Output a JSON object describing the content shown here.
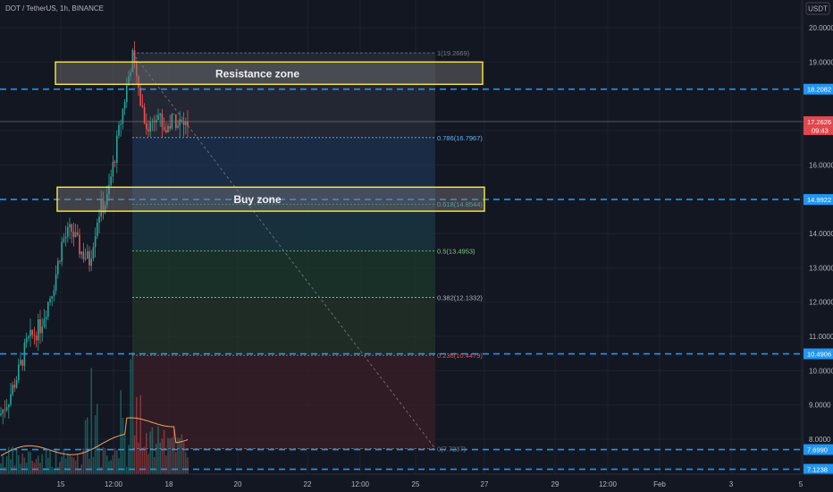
{
  "header": {
    "title": "DOT / TetherUS, 1h, BINANCE"
  },
  "colors": {
    "background": "#131722",
    "grid": "#1e2230",
    "up_candle": "#26a69a",
    "down_candle": "#ef5350",
    "blue_line": "#2196f3",
    "zone_border": "#ffeb3b",
    "fib_upper": "#2a4a6b",
    "fib_mid": "#1e4a3a",
    "fib_lower": "#5a2a30",
    "ma_line": "#f4a261"
  },
  "chart_data": {
    "type": "candlestick",
    "symbol": "DOT / TetherUS",
    "interval": "1h",
    "exchange": "BINANCE",
    "currency": "USDT",
    "ylim": [
      7.0,
      20.3
    ],
    "y_ticks": [
      "20.0000",
      "19.0000",
      "17.0000",
      "16.0000",
      "14.0000",
      "13.0000",
      "12.0000",
      "11.0000",
      "10.0000",
      "9.0000",
      "8.0000"
    ],
    "x_ticks": [
      "15",
      "12:00",
      "18",
      "20",
      "22",
      "12:00",
      "25",
      "27",
      "29",
      "12:00",
      "Feb",
      "3",
      "5"
    ],
    "price_path": [
      [
        0,
        8.7
      ],
      [
        10,
        9.2
      ],
      [
        20,
        9.9
      ],
      [
        30,
        10.8
      ],
      [
        45,
        11.3
      ],
      [
        60,
        12.5
      ],
      [
        70,
        13.8
      ],
      [
        80,
        14.1
      ],
      [
        90,
        13.5
      ],
      [
        100,
        13.2
      ],
      [
        110,
        14.6
      ],
      [
        120,
        15.0
      ],
      [
        130,
        16.5
      ],
      [
        140,
        18.0
      ],
      [
        148,
        19.2
      ],
      [
        155,
        18.2
      ],
      [
        165,
        17.0
      ],
      [
        175,
        17.6
      ],
      [
        185,
        17.0
      ],
      [
        195,
        17.4
      ],
      [
        205,
        17.1
      ],
      [
        212,
        17.3
      ]
    ],
    "horizontal_levels": [
      {
        "label": "18.2082",
        "value": 18.2082
      },
      {
        "label": "14.9922",
        "value": 14.9922
      },
      {
        "label": "10.4906",
        "value": 10.4906
      },
      {
        "label": "7.6990",
        "value": 7.699
      },
      {
        "label": "7.1238",
        "value": 7.1238
      }
    ],
    "current_price": {
      "label": "17.2626",
      "value": 17.2626,
      "countdown": "09:43"
    },
    "fib_levels": [
      {
        "label": "1(19.2669)",
        "ratio": 1.0,
        "value": 19.2669,
        "color": "#787b86"
      },
      {
        "label": "0.786(16.7967)",
        "ratio": 0.786,
        "value": 16.7967,
        "color": "#64b5f6"
      },
      {
        "label": "0.618(14.8544)",
        "ratio": 0.618,
        "value": 14.8544,
        "color": "#4db6ac"
      },
      {
        "label": "0.5(13.4953)",
        "ratio": 0.5,
        "value": 13.4953,
        "color": "#81c784"
      },
      {
        "label": "0.382(12.1332)",
        "ratio": 0.382,
        "value": 12.1332,
        "color": "#b2b5be"
      },
      {
        "label": "0.236(10.4479)",
        "ratio": 0.236,
        "value": 10.4479,
        "color": "#ef5350"
      },
      {
        "label": "0(7.7237)",
        "ratio": 0.0,
        "value": 7.7237,
        "color": "#787b86"
      }
    ],
    "zones": [
      {
        "label": "Resistance zone",
        "top": 19.0,
        "bottom": 18.35
      },
      {
        "label": "Buy zone",
        "top": 15.35,
        "bottom": 14.65
      }
    ]
  }
}
